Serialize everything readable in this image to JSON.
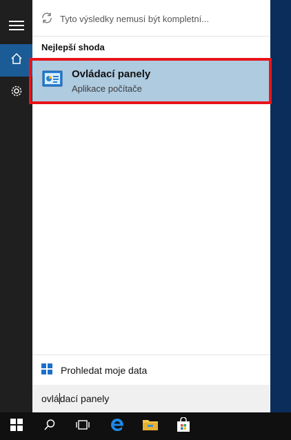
{
  "search_panel": {
    "disclaimer": "Tyto výsledky nemusí být kompletní...",
    "section_heading": "Nejlepší shoda",
    "best_match": {
      "title": "Ovládací panely",
      "subtitle": "Aplikace počítače",
      "icon": "control-panel-icon"
    },
    "my_data_label": "Prohledat moje data",
    "query_before_caret": "ovlá",
    "query_after_caret": "dací panely"
  },
  "left_rail": {
    "items": [
      {
        "icon": "hamburger-menu-icon"
      },
      {
        "icon": "home-icon",
        "active": true
      },
      {
        "icon": "gear-icon"
      }
    ]
  },
  "taskbar": {
    "items": [
      {
        "icon": "windows-start-icon"
      },
      {
        "icon": "search-icon"
      },
      {
        "icon": "task-view-icon"
      },
      {
        "icon": "edge-browser-icon"
      },
      {
        "icon": "file-explorer-icon"
      },
      {
        "icon": "store-icon"
      }
    ]
  },
  "colors": {
    "accent": "#1b5c96",
    "result_highlight": "#afcbe0",
    "annotation_border": "#e8141a",
    "edge_blue": "#1e88e5",
    "explorer_yellow": "#f4c84a"
  }
}
